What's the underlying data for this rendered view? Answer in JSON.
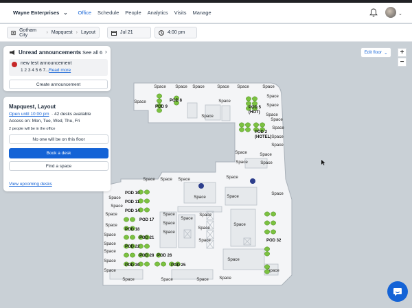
{
  "topbar": {
    "org_name": "Wayne Enterprises",
    "nav": [
      "Office",
      "Schedule",
      "People",
      "Analytics",
      "Visits",
      "Manage"
    ],
    "active_nav": "Office"
  },
  "subbar": {
    "breadcrumb": [
      "Gotham City",
      "Mapquest",
      "Layout"
    ],
    "date": "Jul 21",
    "time": "4:00 pm"
  },
  "announcements": {
    "title": "Unread announcements",
    "see_all": "See all 6",
    "item_title": "new test announcement",
    "item_preview": "1 2 3 4 5 6 7...",
    "read_more": "Read more",
    "create_button": "Create announcement"
  },
  "office": {
    "title": "Mapquest, Layout",
    "open_until": "Open until 10:00 pm",
    "desks": "· 42 desks available",
    "access": "Access on: Mon, Tue, Wed, Thu, Fri",
    "people_note": "2 people will be in the office",
    "nobody_button": "No one will be on this floor",
    "book_button": "Book a desk",
    "find_button": "Find a space",
    "upcoming_link": "View upcoming desks"
  },
  "floor": {
    "edit_floor": "Edit floor",
    "zoom_in": "+",
    "zoom_out": "−",
    "space_label": "Space",
    "pods": [
      "POD 9",
      "POD 8",
      "POD 5 (HOT)",
      "POD 2 (HOTEL)",
      "POD 10",
      "POD 11",
      "POD 14",
      "POD 17",
      "POD 18",
      "POD 21",
      "POD 22",
      "POD 26",
      "POD 28",
      "POD 30",
      "POD 25",
      "POD 32"
    ]
  },
  "colors": {
    "accent": "#1463d6",
    "desk_green": "#7cc241",
    "map_bg": "#c9d0d6",
    "room_fill": "#e9ecef"
  }
}
